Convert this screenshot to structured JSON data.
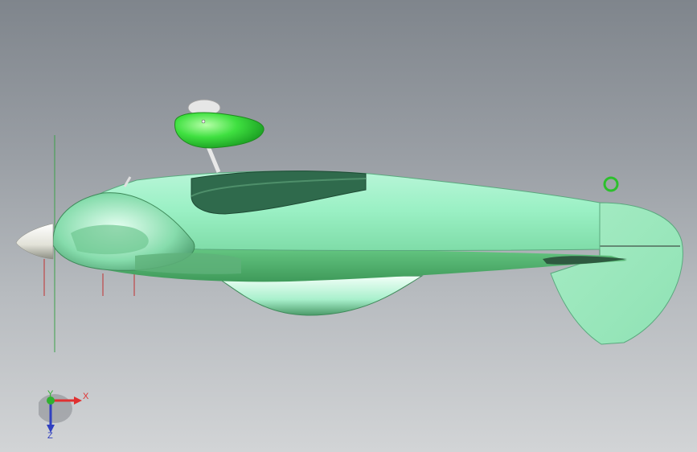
{
  "viewport": {
    "background_top": "#7f858c",
    "background_bottom": "#d2d4d6",
    "model": {
      "fuselage_color": "#8fe8b8",
      "canopy_color": "#2f6a4c",
      "tail_color": "#9fe8bf",
      "pilot_head_color": "#3cdc3c",
      "spinner_color": "#e8e8e0"
    },
    "triad": {
      "x_label": "X",
      "y_label": "Y",
      "z_label": "Z",
      "x_color": "#e03030",
      "y_color": "#30b030",
      "z_color": "#3040c0"
    }
  }
}
